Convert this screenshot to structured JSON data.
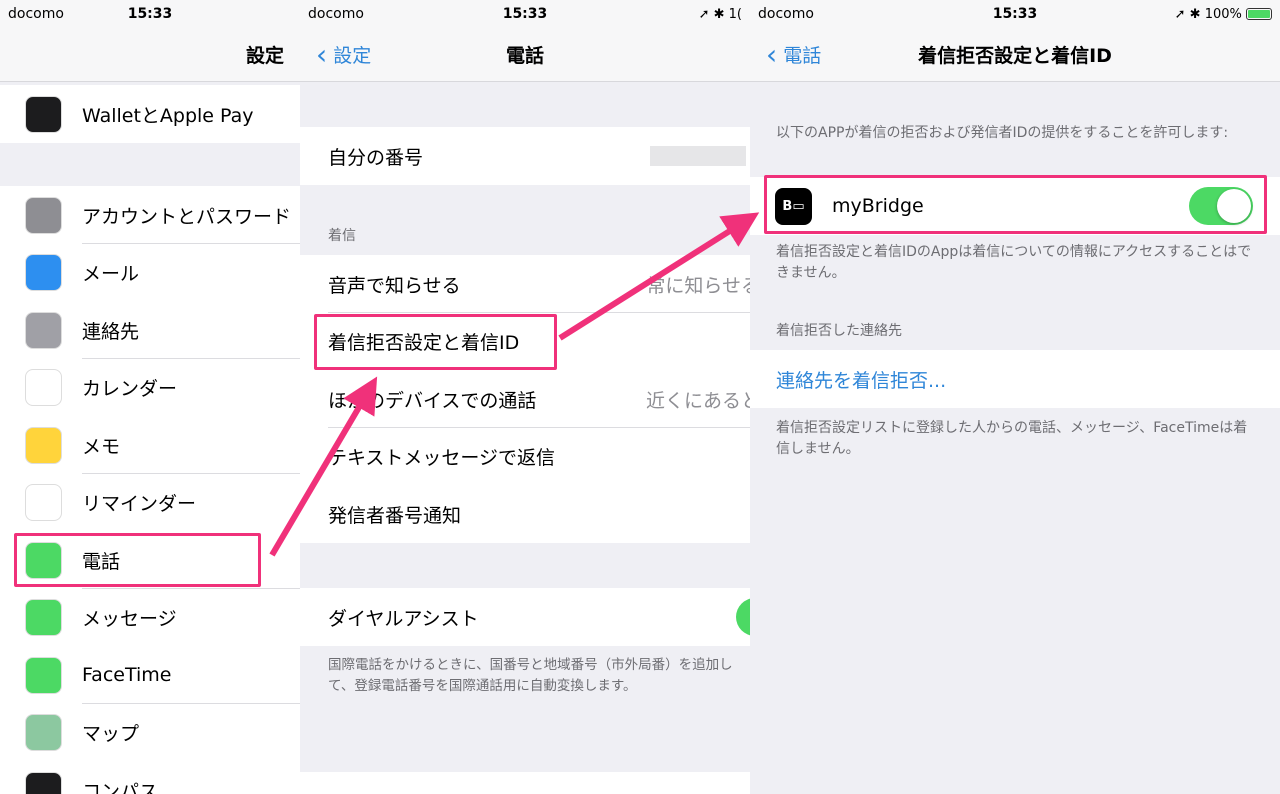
{
  "status": {
    "carrier": "docomo",
    "time": "15:33",
    "right_partial": "1(",
    "right_full": "100%"
  },
  "panel1": {
    "title": "設定",
    "items": [
      {
        "label": "WalletとApple Pay",
        "icon": "wallet-icon",
        "color": "#1c1c1e"
      },
      {
        "label": "アカウントとパスワード",
        "icon": "key-icon",
        "color": "#8e8e93"
      },
      {
        "label": "メール",
        "icon": "mail-icon",
        "color": "#2d8ff0"
      },
      {
        "label": "連絡先",
        "icon": "contacts-icon",
        "color": "#a0a0a6"
      },
      {
        "label": "カレンダー",
        "icon": "calendar-icon",
        "color": "#ffffff"
      },
      {
        "label": "メモ",
        "icon": "notes-icon",
        "color": "#ffd43b"
      },
      {
        "label": "リマインダー",
        "icon": "reminders-icon",
        "color": "#ffffff"
      },
      {
        "label": "電話",
        "icon": "phone-icon",
        "color": "#4cd964"
      },
      {
        "label": "メッセージ",
        "icon": "messages-icon",
        "color": "#4cd964"
      },
      {
        "label": "FaceTime",
        "icon": "facetime-icon",
        "color": "#4cd964"
      },
      {
        "label": "マップ",
        "icon": "maps-icon",
        "color": "#8cc8a0"
      },
      {
        "label": "コンパス",
        "icon": "compass-icon",
        "color": "#1c1c1e"
      }
    ]
  },
  "panel2": {
    "back": "設定",
    "title": "電話",
    "my_number": "自分の番号",
    "section_incoming": "着信",
    "items": [
      {
        "label": "音声で知らせる",
        "value": "常に知らせる"
      },
      {
        "label": "着信拒否設定と着信ID",
        "value": ""
      },
      {
        "label": "ほかのデバイスでの通話",
        "value": "近くにあると"
      },
      {
        "label": "テキストメッセージで返信",
        "value": ""
      },
      {
        "label": "発信者番号通知",
        "value": ""
      }
    ],
    "dial_assist": "ダイヤルアシスト",
    "dial_assist_on": true,
    "dial_assist_footer": "国際電話をかけるときに、国番号と地域番号（市外局番）を追加して、登録電話番号を国際通話用に自動変換します。"
  },
  "panel3": {
    "back": "電話",
    "title": "着信拒否設定と着信ID",
    "header": "以下のAPPが着信の拒否および発信者IDの提供をすることを許可します:",
    "app": {
      "name": "myBridge",
      "icon_text": "B",
      "enabled": true
    },
    "footer1": "着信拒否設定と着信IDのAppは着信についての情報にアクセスすることはできません。",
    "section_blocked": "着信拒否した連絡先",
    "block_link": "連絡先を着信拒否...",
    "footer2": "着信拒否設定リストに登録した人からの電話、メッセージ、FaceTimeは着信しません。"
  },
  "colors": {
    "accent": "#2f86d8",
    "highlight": "#f0317a",
    "toggle": "#4cd964"
  }
}
